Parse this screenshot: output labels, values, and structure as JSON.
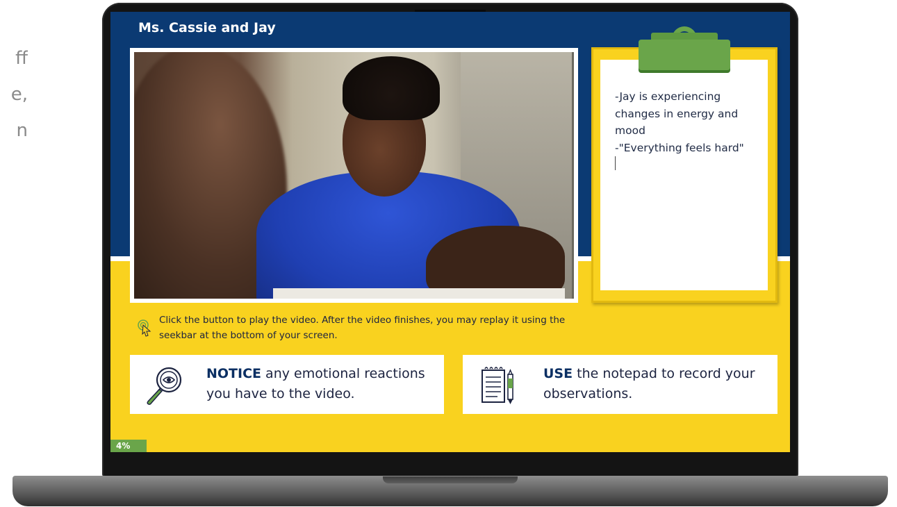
{
  "side_text": [
    "ff",
    "e,",
    "n"
  ],
  "screen": {
    "title": "Ms. Cassie and Jay",
    "video": {
      "description_icon": "video-still"
    },
    "notepad": {
      "notes": "-Jay is experiencing changes in energy and mood\n-\"Everything feels hard\""
    },
    "instruction": "Click the button to play the video. After the video finishes, you may replay it using the seekbar at the bottom of your screen.",
    "cards": [
      {
        "keyword": "NOTICE",
        "text": " any emotional reactions you have to the video.",
        "icon": "magnifier-eye-icon"
      },
      {
        "keyword": "USE",
        "text": " the notepad to record your observations.",
        "icon": "notepad-pen-icon"
      }
    ],
    "progress": "4%"
  },
  "colors": {
    "navy": "#0b3a73",
    "yellow": "#f9d21f",
    "green": "#6aa54a",
    "text_dark": "#1c2340"
  }
}
